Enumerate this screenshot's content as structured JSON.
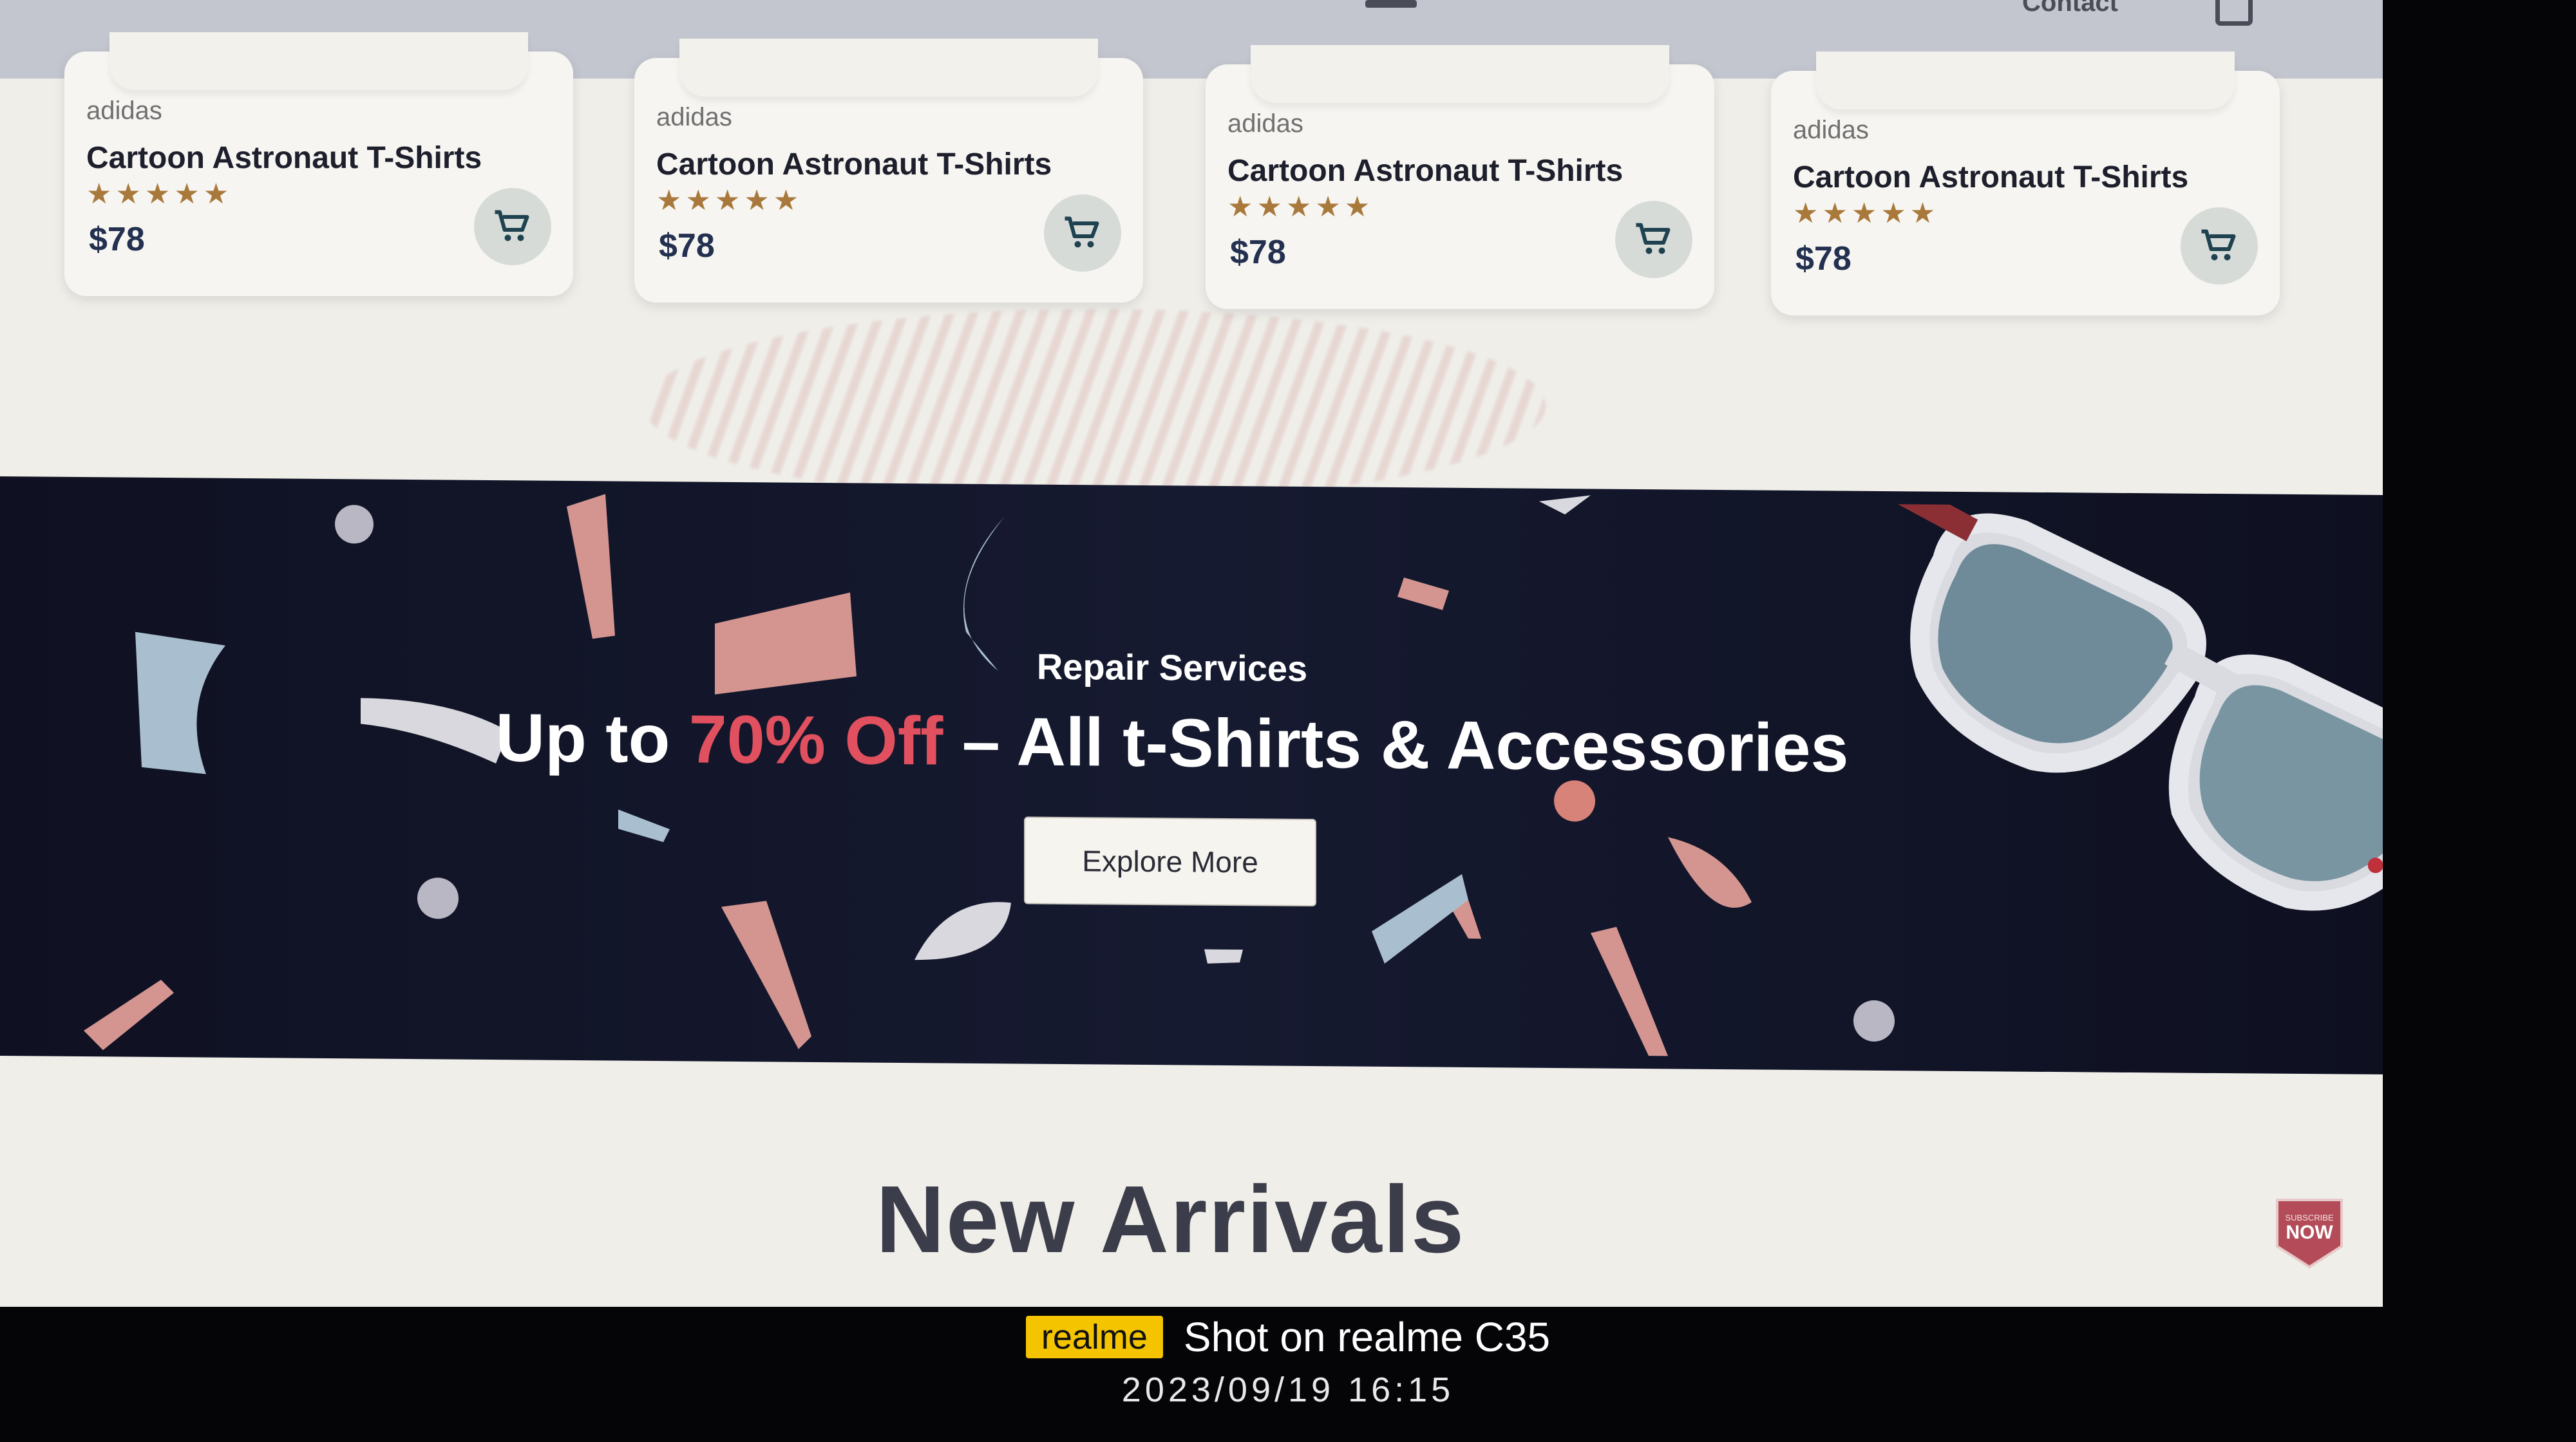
{
  "header": {
    "nav_item": "Contact"
  },
  "products": [
    {
      "brand": "adidas",
      "title": "Cartoon Astronaut T-Shirts",
      "stars": "★★★★★",
      "price": "$78"
    },
    {
      "brand": "adidas",
      "title": "Cartoon Astronaut T-Shirts",
      "stars": "★★★★★",
      "price": "$78"
    },
    {
      "brand": "adidas",
      "title": "Cartoon Astronaut T-Shirts",
      "stars": "★★★★★",
      "price": "$78"
    },
    {
      "brand": "adidas",
      "title": "Cartoon Astronaut T-Shirts",
      "stars": "★★★★★",
      "price": "$78"
    }
  ],
  "product_rating": "5 of 5",
  "banner": {
    "subtitle": "Repair Services",
    "headline_prefix": "Up to ",
    "headline_accent": "70% Off",
    "headline_suffix": " – All t-Shirts & Accessories",
    "button_label": "Explore More"
  },
  "section": {
    "title": "New Arrivals"
  },
  "subscribe_badge": {
    "small": "SUBSCRIBE",
    "large": "NOW"
  },
  "camera_watermark": {
    "logo": "realme",
    "text": "Shot on realme C35",
    "datetime": "2023/09/19  16:15"
  },
  "icons": [
    "cart-icon",
    "menu-icon",
    "bag-icon",
    "sunglasses-image",
    "subscribe-badge"
  ],
  "colors": {
    "accent": "#e0505f",
    "banner_bg": "#12152a",
    "star": "#a9793c",
    "price": "#233050",
    "watermark_logo": "#f5c400"
  }
}
